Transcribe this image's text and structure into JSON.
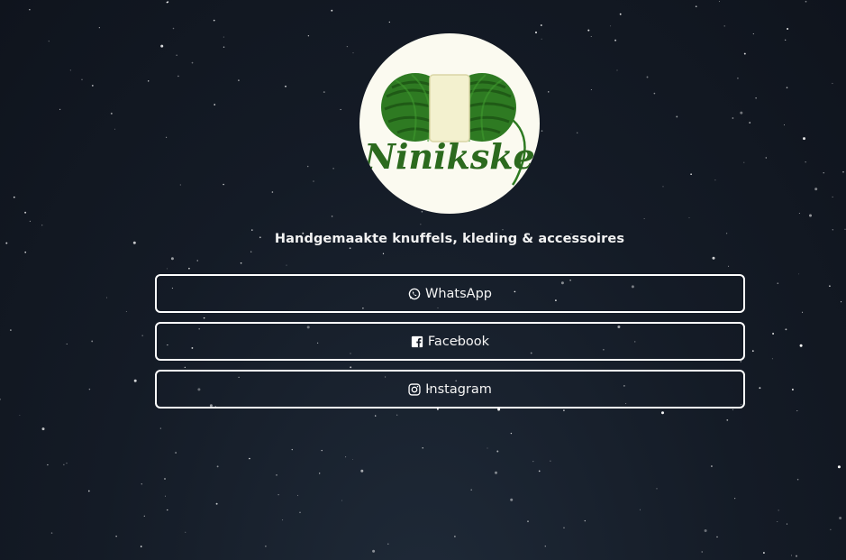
{
  "profile": {
    "logo_text": "Ninikske",
    "tagline": "Handgemaakte knuffels, kleding & accessoires"
  },
  "links": [
    {
      "label": "WhatsApp",
      "icon": "whatsapp-icon"
    },
    {
      "label": "Facebook",
      "icon": "facebook-icon"
    },
    {
      "label": "Instagram",
      "icon": "instagram-icon"
    }
  ],
  "colors": {
    "background": "#141b26",
    "button_border": "#ffffff",
    "avatar_background": "#fbfaf0",
    "yarn_green": "#2f7a24"
  }
}
